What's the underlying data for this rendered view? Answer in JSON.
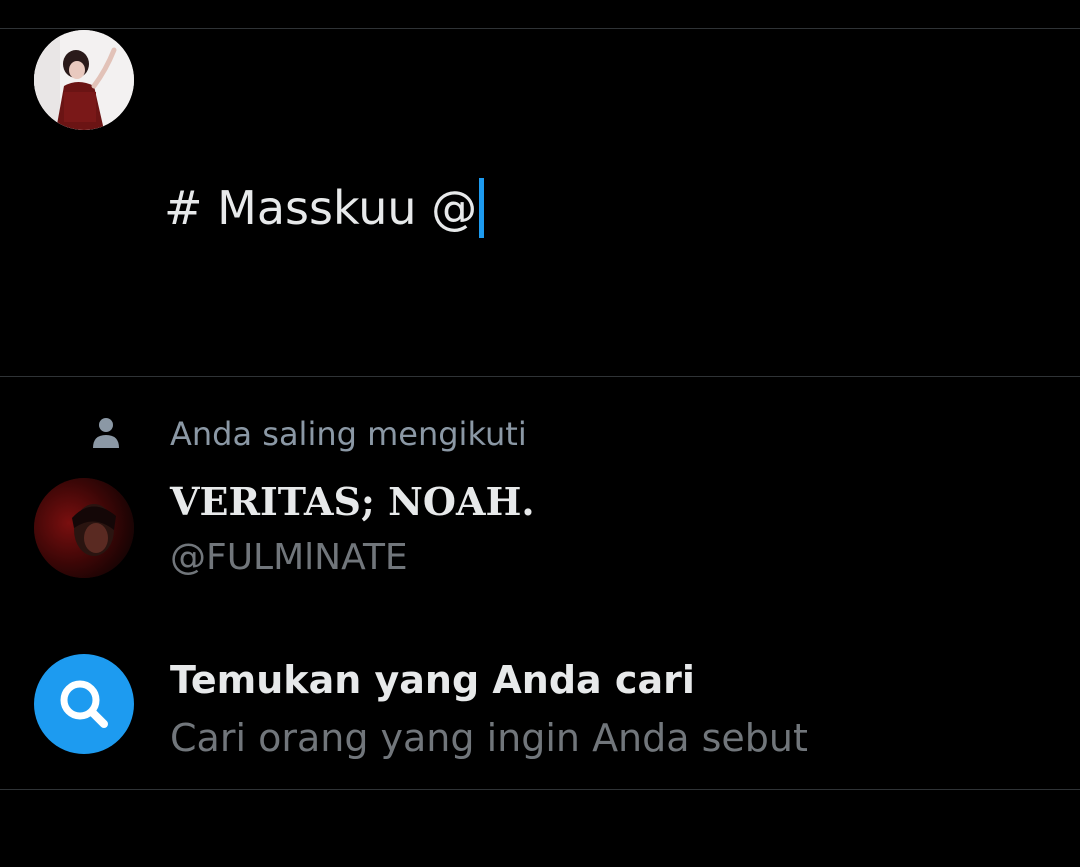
{
  "colors": {
    "background": "#000000",
    "divider": "#2f3336",
    "text_primary": "#e7e9ea",
    "text_secondary": "#71767b",
    "accent": "#1d9bf0"
  },
  "composer": {
    "avatar_icon": "user-avatar-photo",
    "text": "# Masskuu @"
  },
  "mention_suggestion": {
    "context_icon": "person-icon",
    "context_label": "Anda saling mengikuti",
    "avatar_icon": "user-avatar-photo",
    "display_name": "VERITAS; NOAH.",
    "handle": "@FULMlNATE"
  },
  "search_suggestion": {
    "icon": "search-icon",
    "title": "Temukan yang Anda cari",
    "subtitle": "Cari orang yang ingin Anda sebut"
  }
}
